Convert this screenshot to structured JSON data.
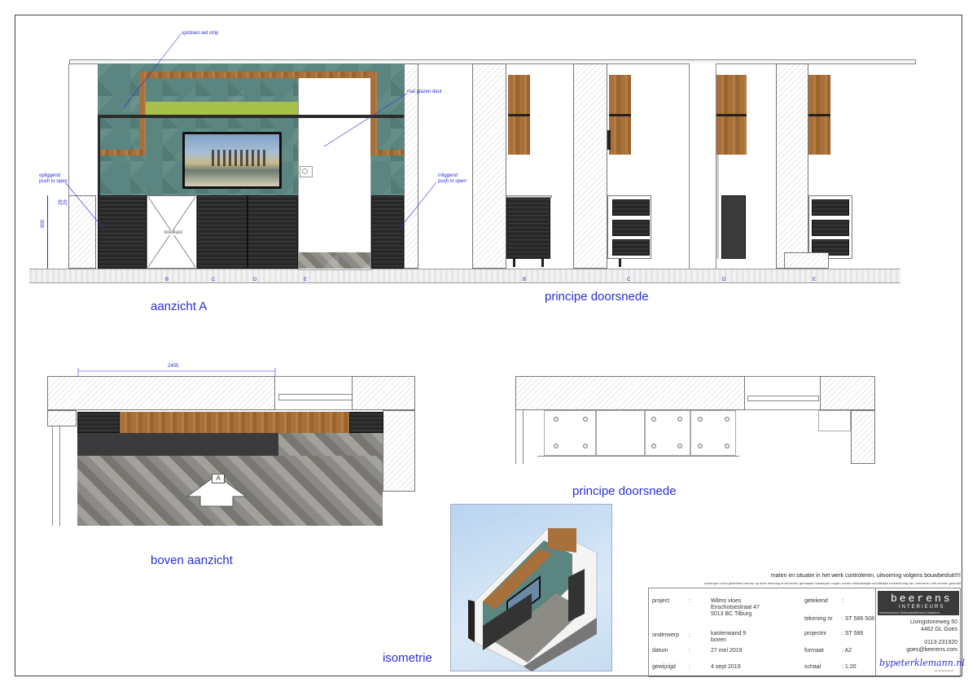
{
  "views": {
    "aanzicht_title": "aanzicht A",
    "doorsnede_title_1": "principe doorsnede",
    "doorsnede_title_2": "principe doorsnede",
    "boven_title": "boven aanzicht",
    "isometrie_title": "isometrie"
  },
  "annotations": {
    "led_strip": "up/down led strip",
    "glass_door": "mat glazen deur",
    "left_push": "opliggend\npush to open",
    "right_push": "inliggend\npush to open",
    "koelkast": "koelkast",
    "height_900": "900",
    "height_28": "28",
    "height_25": "25",
    "width_2405": "2405",
    "marker_a": "A"
  },
  "section_letters": [
    "B",
    "C",
    "D",
    "E",
    "B",
    "C",
    "D",
    "E"
  ],
  "titleblock": {
    "warning_main": "maten en situatie in het werk controleren, uitvoering volgens bouwbesluit!!!!",
    "warning_small": "ontwerpen en/of gedeelten hiervan op deze tekening en/of eerder gemaakte ontwerpen mogen zonder uitdrukkelijke schriftelijke toestemming van <beerens> niet worden gebruikt",
    "rows": [
      {
        "label": "project",
        "sep": ":",
        "value": "Wilms vloes\nEnschotsestraat 47\n5013 BC Tilburg",
        "label2": "getekend",
        "sep2": ":",
        "value2": ""
      },
      {
        "label": "",
        "sep": "",
        "value": "",
        "label2": "tekening nr",
        "sep2": "",
        "value2": ": ST 586 508"
      },
      {
        "label": "onderwerp",
        "sep": ":",
        "value": "kastenwand 9\nboven",
        "label2": "projectnr",
        "sep2": "",
        "value2": ": ST 586"
      },
      {
        "label": "datum",
        "sep": ":",
        "value": "27 mei 2019",
        "label2": "formaat",
        "sep2": "",
        "value2": ": A2"
      },
      {
        "label": "gewijzigd",
        "sep": ":",
        "value": "4 sept 2019",
        "label2": "schaal",
        "sep2": "",
        "value2": ": 1:20"
      }
    ],
    "logo_text": "beerens",
    "logo_sub": "INTERIEURS",
    "logo_tags": "Interieurbouw  Scheepsinterieurs  Maakers",
    "address1": "Livingstoneweg 50",
    "address2": "4462 GL Goes",
    "phone": "0113-231920",
    "email": "goes@beerens.com",
    "signature": "bypeterklemann.nl",
    "signature_sub": "NL   design/interior"
  }
}
